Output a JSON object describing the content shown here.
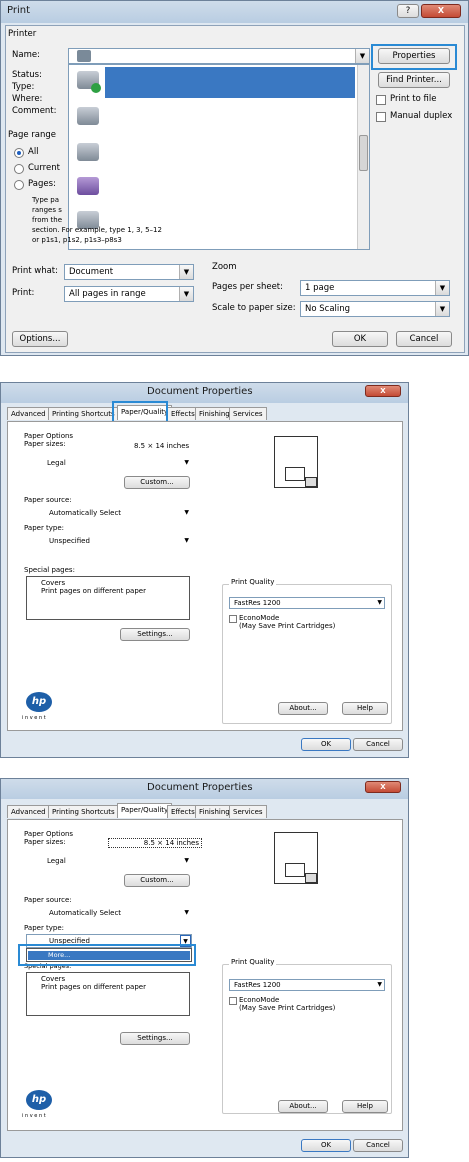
{
  "print": {
    "title": "Print",
    "help": "?",
    "close": "X",
    "printer_group": "Printer",
    "name_label": "Name:",
    "status_label": "Status:",
    "type_label": "Type:",
    "where_label": "Where:",
    "comment_label": "Comment:",
    "properties": "Properties",
    "find_printer": "Find Printer...",
    "print_to_file": "Print to file",
    "manual_duplex": "Manual duplex",
    "page_range": "Page range",
    "all": "All",
    "current": "Current",
    "pages": "Pages:",
    "help_line1": "Type pa",
    "help_line2": "ranges s",
    "help_line3": "from the",
    "help_line4": "section. For example, type 1, 3, 5–12",
    "help_line5": "or p1s1, p1s2, p1s3–p8s3",
    "print_what_label": "Print what:",
    "print_what_value": "Document",
    "print_label": "Print:",
    "print_value": "All pages in range",
    "zoom": "Zoom",
    "pages_per_sheet_label": "Pages per sheet:",
    "pages_per_sheet_value": "1 page",
    "scale_label": "Scale to paper size:",
    "scale_value": "No Scaling",
    "options": "Options...",
    "ok": "OK",
    "cancel": "Cancel"
  },
  "props": {
    "title": "Document Properties",
    "close": "X",
    "tabs": [
      "Advanced",
      "Printing Shortcuts",
      "Paper/Quality",
      "Effects",
      "Finishing",
      "Services"
    ],
    "paper_options": "Paper Options",
    "paper_sizes_label": "Paper sizes:",
    "paper_size_dims": "8.5 × 14 inches",
    "paper_size_value": "Legal",
    "custom": "Custom...",
    "paper_source_label": "Paper source:",
    "paper_source_value": "Automatically Select",
    "paper_type_label": "Paper type:",
    "paper_type_value": "Unspecified",
    "special_pages_label": "Special pages:",
    "special_item1": "Covers",
    "special_item2": "Print pages on different paper",
    "settings": "Settings...",
    "print_quality": "Print Quality",
    "quality_value": "FastRes 1200",
    "econo_line1": "EconoMode",
    "econo_line2": "(May Save Print Cartridges)",
    "logo": "hp",
    "invent": "i n v e n t",
    "about": "About...",
    "help": "Help",
    "ok": "OK",
    "cancel": "Cancel"
  },
  "props2": {
    "more": "More...",
    "special_partial": "Special pages:"
  },
  "colors": {
    "highlight": "#2a8ad4",
    "selection": "#3a78c2",
    "hp_blue": "#1e5fa8"
  }
}
